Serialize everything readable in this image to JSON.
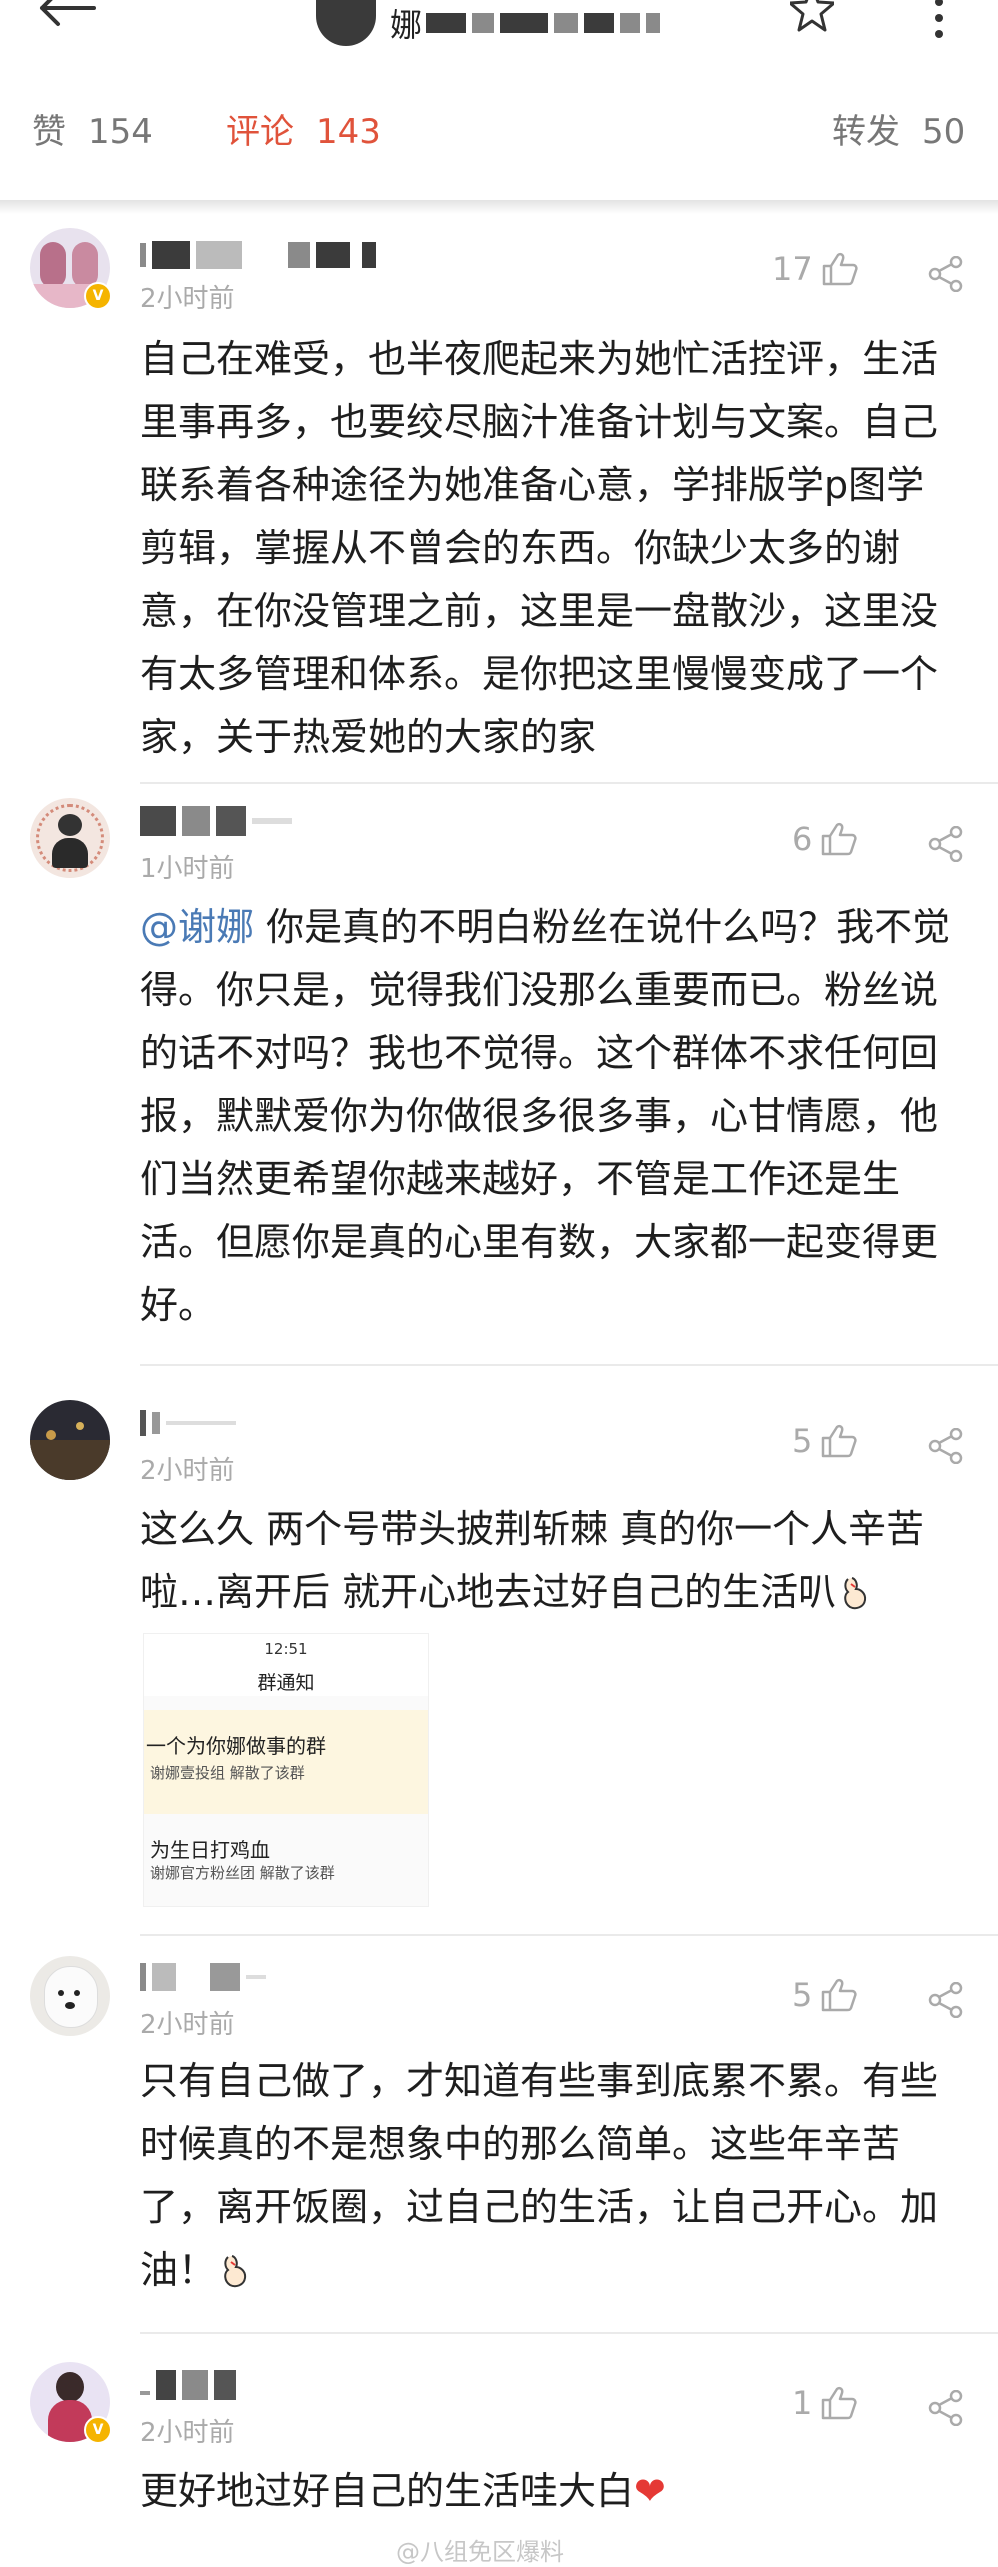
{
  "header": {
    "title_char": "娜",
    "icons": {
      "back": "back-arrow-icon",
      "favorite": "star-icon",
      "more": "more-vertical-icon"
    }
  },
  "stats": {
    "likes_label": "赞",
    "likes_count": "154",
    "comments_label": "评论",
    "comments_count": "143",
    "reposts_label": "转发",
    "reposts_count": "50",
    "active_color": "#e0533b"
  },
  "comments": [
    {
      "time": "2小时前",
      "likes": "17",
      "verified": "V",
      "text": "自己在难受，也半夜爬起来为她忙活控评，生活里事再多，也要绞尽脑汁准备计划与文案。自己联系着各种途径为她准备心意，学排版学p图学剪辑，掌握从不曾会的东西。你缺少太多的谢意，在你没管理之前，这里是一盘散沙，这里没有太多管理和体系。是你把这里慢慢变成了一个家，关于热爱她的大家的家"
    },
    {
      "time": "1小时前",
      "likes": "6",
      "mention": "@谢娜",
      "text": " 你是真的不明白粉丝在说什么吗？我不觉得。你只是，觉得我们没那么重要而已。粉丝说的话不对吗？我也不觉得。这个群体不求任何回报，默默爱你为你做很多很多事，心甘情愿，他们当然更希望你越来越好，不管是工作还是生活。但愿你是真的心里有数，大家都一起变得更好。"
    },
    {
      "time": "2小时前",
      "likes": "5",
      "text": "这么久 两个号带头披荆斩棘 真的你一个人辛苦啦…离开后 就开心地去过好自己的生活叭",
      "image": {
        "time": "12:51",
        "title": "群通知",
        "row1_title": "一个为你娜做事的群",
        "row1_sub": "谢娜壹投组 解散了该群",
        "row2_title": "为生日打鸡血",
        "row2_sub": "谢娜官方粉丝团 解散了该群"
      }
    },
    {
      "time": "2小时前",
      "likes": "5",
      "text": "只有自己做了，才知道有些事到底累不累。有些时候真的不是想象中的那么简单。这些年辛苦了，离开饭圈，过自己的生活，让自己开心。加油！"
    },
    {
      "time": "2小时前",
      "likes": "1",
      "verified": "V",
      "text": "更好地过好自己的生活哇大白",
      "heart": "❤"
    }
  ],
  "watermark": "@八组免区爆料"
}
